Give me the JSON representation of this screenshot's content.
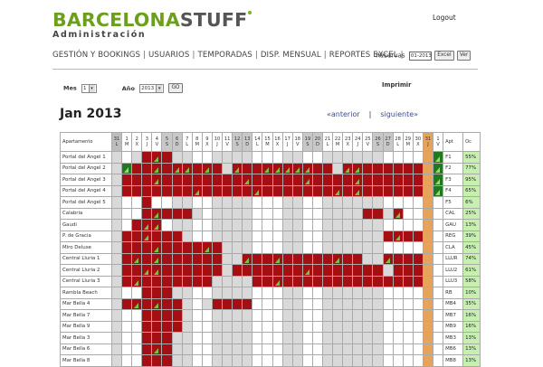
{
  "logo": {
    "part1": "BARCELONA",
    "part2": "STUFF",
    "subtitle": "Administración"
  },
  "logout": "Logout",
  "nav": [
    {
      "label": "GESTIÓN Y BOOKINGS"
    },
    {
      "label": "USUARIOS"
    },
    {
      "label": "TEMPORADAS"
    },
    {
      "label": "DISP. MENSUAL"
    },
    {
      "label": "REPORTES EXCEL"
    }
  ],
  "reservas": {
    "label": "Reservas",
    "value": "01-2013",
    "excel_btn": "Excel",
    "ver_btn": "Ver"
  },
  "filters": {
    "mes_label": "Mes",
    "mes_value": "1",
    "ano_label": "Año",
    "ano_value": "2013",
    "go": "GO"
  },
  "print": "Imprimir",
  "month_title": "Jan 2013",
  "pager": {
    "prev": "«anterior",
    "next": "siguiente»"
  },
  "colors": {
    "booked": "#a50f14",
    "free": "#ffffff",
    "weekend": "#d9d9d9",
    "checkin_flag": "#7bc143",
    "occupancy_bg": "#c6efb0"
  },
  "table": {
    "apt_header": "Apartamento",
    "abbr_header": "Apt",
    "occ_header": "Oc",
    "days": [
      {
        "n": "31",
        "w": "L"
      },
      {
        "n": "1",
        "w": "M"
      },
      {
        "n": "2",
        "w": "X"
      },
      {
        "n": "3",
        "w": "J"
      },
      {
        "n": "4",
        "w": "V"
      },
      {
        "n": "5",
        "w": "S"
      },
      {
        "n": "6",
        "w": "D"
      },
      {
        "n": "7",
        "w": "L"
      },
      {
        "n": "8",
        "w": "M"
      },
      {
        "n": "9",
        "w": "X"
      },
      {
        "n": "10",
        "w": "J"
      },
      {
        "n": "11",
        "w": "V"
      },
      {
        "n": "12",
        "w": "S"
      },
      {
        "n": "13",
        "w": "D"
      },
      {
        "n": "14",
        "w": "L"
      },
      {
        "n": "15",
        "w": "M"
      },
      {
        "n": "16",
        "w": "X"
      },
      {
        "n": "17",
        "w": "J"
      },
      {
        "n": "18",
        "w": "V"
      },
      {
        "n": "19",
        "w": "S"
      },
      {
        "n": "20",
        "w": "D"
      },
      {
        "n": "21",
        "w": "L"
      },
      {
        "n": "22",
        "w": "M"
      },
      {
        "n": "23",
        "w": "X"
      },
      {
        "n": "24",
        "w": "J"
      },
      {
        "n": "25",
        "w": "V"
      },
      {
        "n": "26",
        "w": "S"
      },
      {
        "n": "27",
        "w": "D"
      },
      {
        "n": "28",
        "w": "L"
      },
      {
        "n": "29",
        "w": "M"
      },
      {
        "n": "30",
        "w": "X"
      },
      {
        "n": "31",
        "w": "J"
      },
      {
        "n": "1",
        "w": "V"
      }
    ],
    "rows": [
      {
        "name": "Portal del Angel 1",
        "abbr": "F1",
        "occ": "55%",
        "cells": "GWGRRRGGWWGGGGWWWGGWWGGGGGGWWWWGE",
        "tri": [
          4,
          7,
          9,
          22
        ]
      },
      {
        "name": "Portal del Angel 2",
        "abbr": "F2",
        "occ": "77%",
        "cells": "GERRRRRRRRRGRRRRRRRRRRGRRRRRRRRGE",
        "tri": [
          4,
          6,
          7,
          9,
          12,
          15,
          16,
          17,
          18,
          19,
          23,
          24
        ]
      },
      {
        "name": "Portal del Angel 3",
        "abbr": "F3",
        "occ": "95%",
        "cells": "GRRRRRRRRRRRRRRRRRRRRRRRRRRRRRRRE",
        "tri": [
          4,
          13,
          19,
          24
        ]
      },
      {
        "name": "Portal del Angel 4",
        "abbr": "F4",
        "occ": "65%",
        "cells": "GRRRRRRRRRRRRRRRRRRRRRRRRRRRRRRRE",
        "tri": [
          8,
          14,
          22,
          24
        ]
      },
      {
        "name": "Portal del Angel 5",
        "abbr": "F5",
        "occ": "6%",
        "cells": "GWWRWWGGWWGGGGWWWGGWWGGGGGGWWWWGW",
        "tri": []
      },
      {
        "name": "Calabria",
        "abbr": "CAL",
        "occ": "25%",
        "cells": "GWWRRRRRGWGGGGWWWGGWWGGGGRRGRWWGW",
        "tri": [
          4,
          28
        ]
      },
      {
        "name": "Gaudi",
        "abbr": "GAU",
        "occ": "13%",
        "cells": "GWRRRWGGWWGGGGWWWGGWWGGGGGGWWWWGW",
        "tri": [
          3,
          4
        ]
      },
      {
        "name": "P. de Gracia",
        "abbr": "REG",
        "occ": "39%",
        "cells": "GRRRRRRGWWGGGGWWWGGWWGGGGGGRRRRGW",
        "tri": [
          3,
          28
        ]
      },
      {
        "name": "Miro Deluxe",
        "abbr": "CLA",
        "occ": "45%",
        "cells": "GRRRRRRRRRRGGGWWWGGWWGGGGGGWWWWGW",
        "tri": [
          4,
          9
        ]
      },
      {
        "name": "Central Lluria 1",
        "abbr": "LLUR",
        "occ": "74%",
        "cells": "GRRRRRRRRRRGGRRRRRRRRRRRRGGRRRRGW",
        "tri": [
          2,
          4,
          13,
          16,
          22,
          27
        ]
      },
      {
        "name": "Central Lluria 2",
        "abbr": "LLU2",
        "occ": "61%",
        "cells": "GRRRRRRRRRRGRRRRRRRRRRRRRRRGRRRGW",
        "tri": [
          3,
          4,
          19,
          27
        ]
      },
      {
        "name": "Central Lluria 3",
        "abbr": "LLU3",
        "occ": "58%",
        "cells": "GRRRRRRRRRGGGGRRRRRRRRRRRRRRRRRGW",
        "tri": [
          2,
          13,
          16
        ]
      },
      {
        "name": "Rambla Beach",
        "abbr": "RB",
        "occ": "10%",
        "cells": "GWWRRRGGWWGGGGWWWGGWWGGGGGGWWWWGW",
        "tri": []
      },
      {
        "name": "Mar Bella 4",
        "abbr": "MB4",
        "occ": "35%",
        "cells": "GRRRRRRGWGRRRRWWWGGWWGGGGGGWWWWGW",
        "tri": [
          2,
          4,
          15,
          24
        ]
      },
      {
        "name": "Mar Bella 7",
        "abbr": "MB7",
        "occ": "16%",
        "cells": "GWWRRRRGWWGGGGWWWGGWWGGGGGGWWWWGW",
        "tri": [
          2
        ]
      },
      {
        "name": "Mar Bella 9",
        "abbr": "MB9",
        "occ": "16%",
        "cells": "GWWRRRRGWWGGGGWWWGGWWGGGGGGWWWWGW",
        "tri": [
          2
        ]
      },
      {
        "name": "Mar Bella 3",
        "abbr": "MB3",
        "occ": "13%",
        "cells": "GWWRRRGGWWGGGGWWWGGWWGGGGGGWWWWGW",
        "tri": [
          2
        ]
      },
      {
        "name": "Mar Bella 6",
        "abbr": "MB6",
        "occ": "13%",
        "cells": "GWWRRRGGWWGGGGWWWGGWWGGGGGGWWWWGW",
        "tri": [
          2,
          4
        ]
      },
      {
        "name": "Mar Bella 8",
        "abbr": "MB8",
        "occ": "13%",
        "cells": "GWWRRRGGWWGGGGWWWGGWWGGGGGGWWWWGW",
        "tri": [
          2
        ]
      }
    ]
  }
}
